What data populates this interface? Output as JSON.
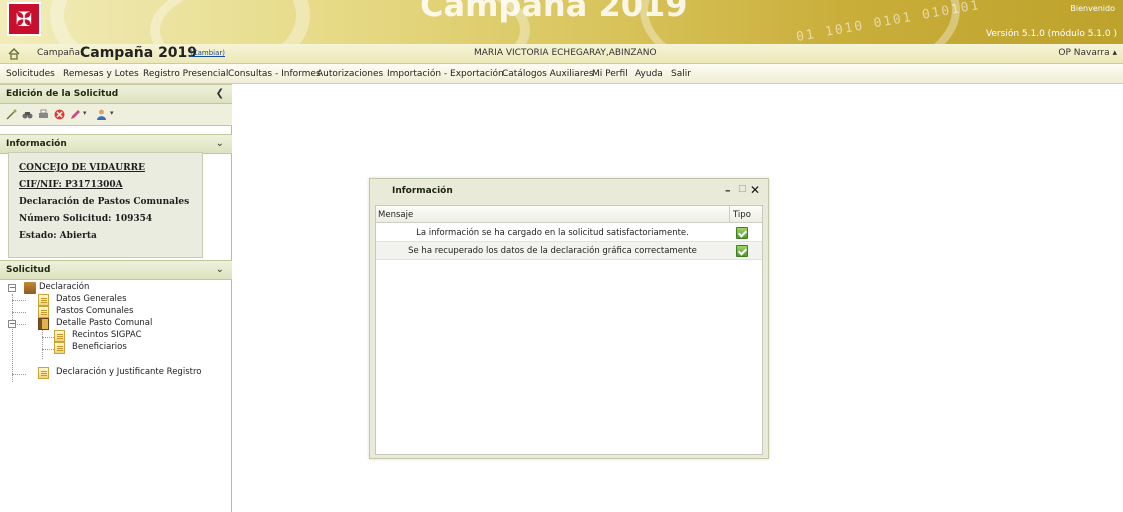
{
  "banner": {
    "title": "Campaña 2019",
    "binary": "01 1010 0101 010101",
    "welcome": "Bienvenido",
    "version": "Versión 5.1.0 (módulo 5.1.0 )"
  },
  "campaign_bar": {
    "label": "Campaña:",
    "value": "Campaña 2019",
    "change_link": "(Cambiar)",
    "user": "MARIA VICTORIA ECHEGARAY,ABINZANO",
    "org": "OP Navarra ▴"
  },
  "menu": [
    "Solicitudes",
    "Remesas y Lotes",
    "Registro Presencial",
    "Consultas - Informes",
    "Autorizaciones",
    "Importación - Exportación",
    "Catálogos Auxiliares",
    "Mi Perfil",
    "Ayuda",
    "Salir"
  ],
  "sidebar": {
    "edit_panel_title": "Edición de la Solicitud",
    "info_panel_title": "Información",
    "info": {
      "entity": "CONCEJO DE VIDAURRE",
      "cif": "CIF/NIF: P3171300A",
      "declaration": "Declaración de Pastos Comunales",
      "request_number": "Número Solicitud: 109354",
      "status": "Estado: Abierta"
    },
    "request_panel_title": "Solicitud",
    "tree": [
      "Declaración",
      "Datos Generales",
      "Pastos Comunales",
      "Detalle Pasto Comunal",
      "Recintos SIGPAC",
      "Beneficiarios",
      "Declaración y Justificante Registro"
    ]
  },
  "dialog": {
    "title": "Información",
    "columns": [
      "Mensaje",
      "Tipo"
    ],
    "rows": [
      "La información se ha cargado en la solicitud satisfactoriamente.",
      "Se ha recuperado los datos de la declaración gráfica correctamente"
    ]
  }
}
